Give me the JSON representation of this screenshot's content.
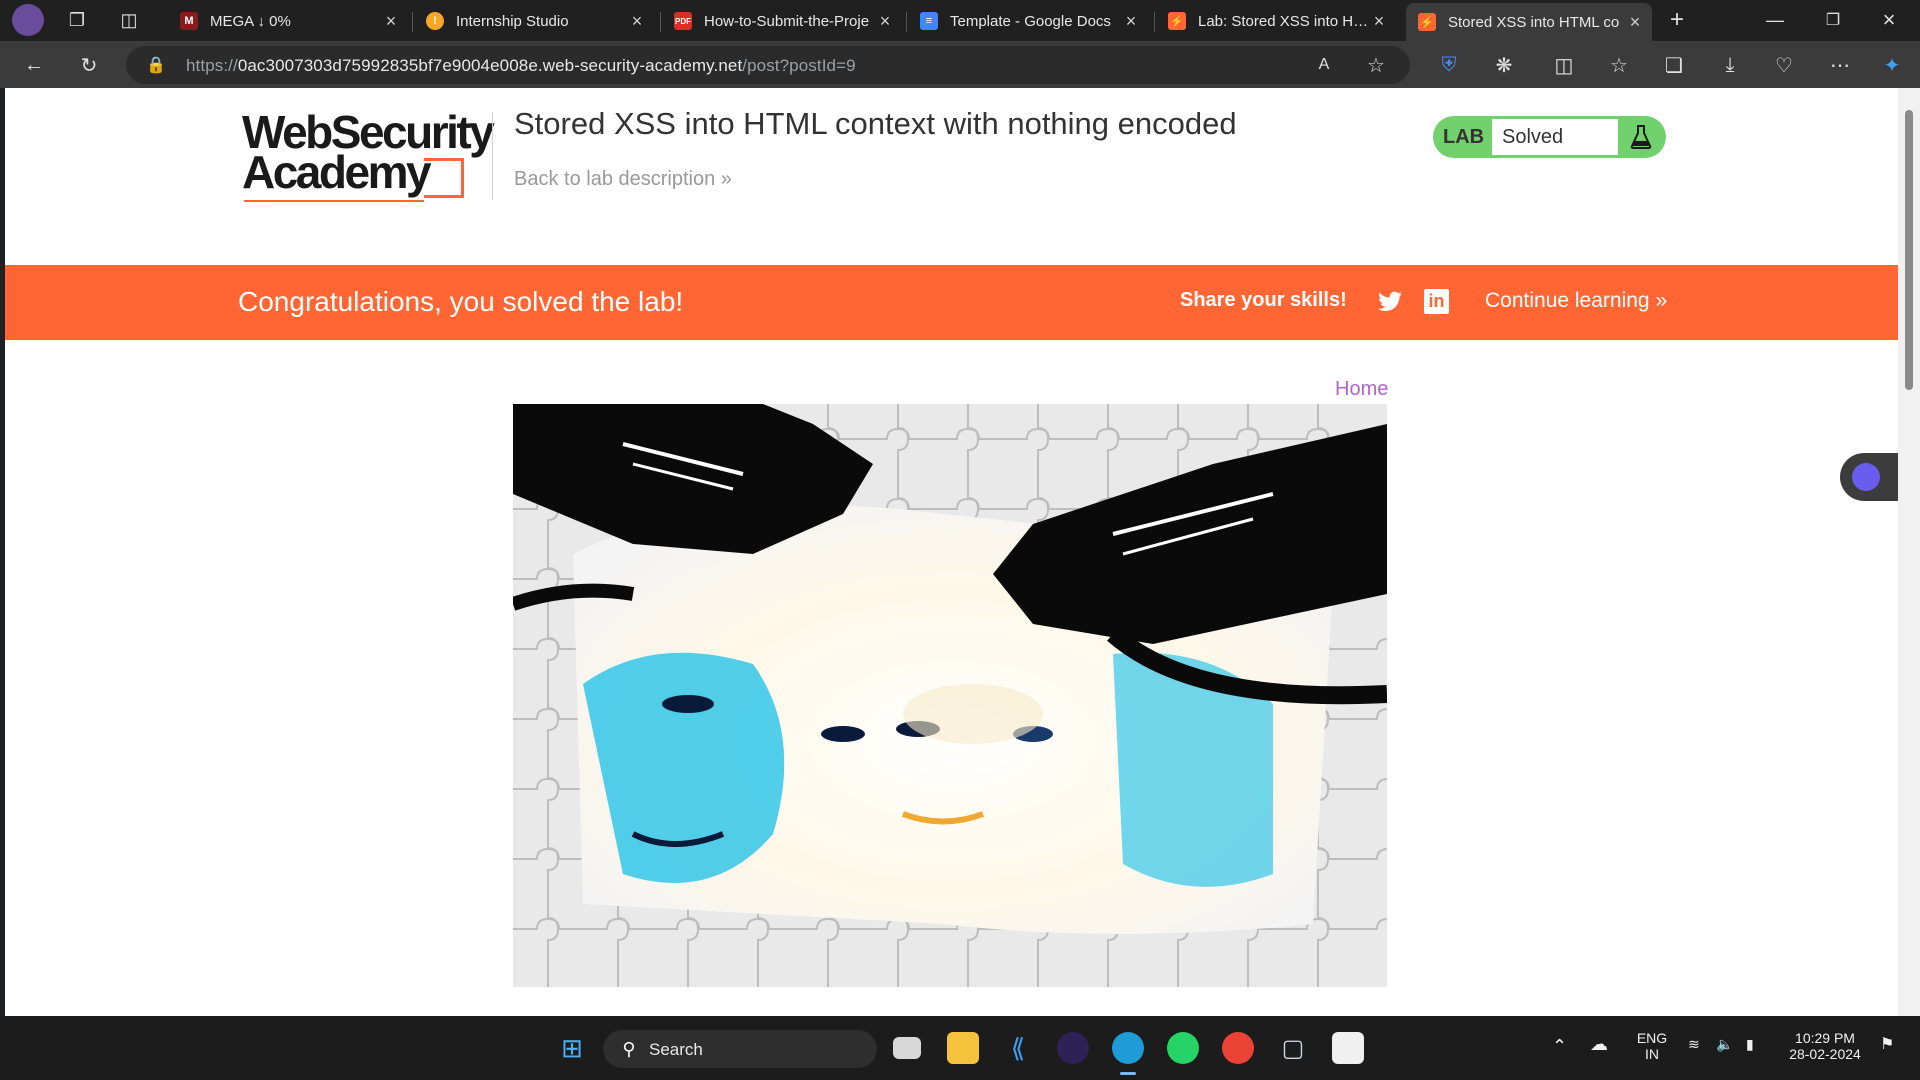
{
  "browser": {
    "tabs": [
      {
        "title": "MEGA ↓ 0%",
        "icon": "mega-icon",
        "color": "#8b1a1a"
      },
      {
        "title": "Internship Studio",
        "icon": "internship-studio-icon",
        "color": "#f5a623"
      },
      {
        "title": "How-to-Submit-the-Proje",
        "icon": "pdf-icon",
        "color": "#d93025"
      },
      {
        "title": "Template - Google Docs",
        "icon": "google-docs-icon",
        "color": "#4285f4"
      },
      {
        "title": "Lab: Stored XSS into HTM",
        "icon": "portswigger-icon",
        "color": "#ff6633"
      },
      {
        "title": "Stored XSS into HTML co",
        "icon": "portswigger-icon",
        "color": "#ff6633"
      }
    ],
    "url": {
      "scheme": "https://",
      "host": "0ac3007303d75992835bf7e9004e008e.web-security-academy.net",
      "path": "/post?postId=9"
    }
  },
  "header": {
    "logo_line1": "WebSecurity",
    "logo_line2": "Academy",
    "lab_title": "Stored XSS into HTML context with nothing encoded",
    "back_link": "Back to lab description",
    "lab_label": "LAB",
    "lab_status": "Solved"
  },
  "banner": {
    "congrats": "Congratulations, you solved the lab!",
    "share": "Share your skills!",
    "continue": "Continue learning"
  },
  "post": {
    "home_link": "Home",
    "image_alt": "puzzle-faces-surveillance-cameras"
  },
  "taskbar": {
    "search": "Search",
    "lang1": "ENG",
    "lang2": "IN",
    "time": "10:29 PM",
    "date": "28-02-2024"
  },
  "colors": {
    "accent": "#ff6633",
    "lab_solved": "#70d16d",
    "link_purple": "#b066c6"
  }
}
